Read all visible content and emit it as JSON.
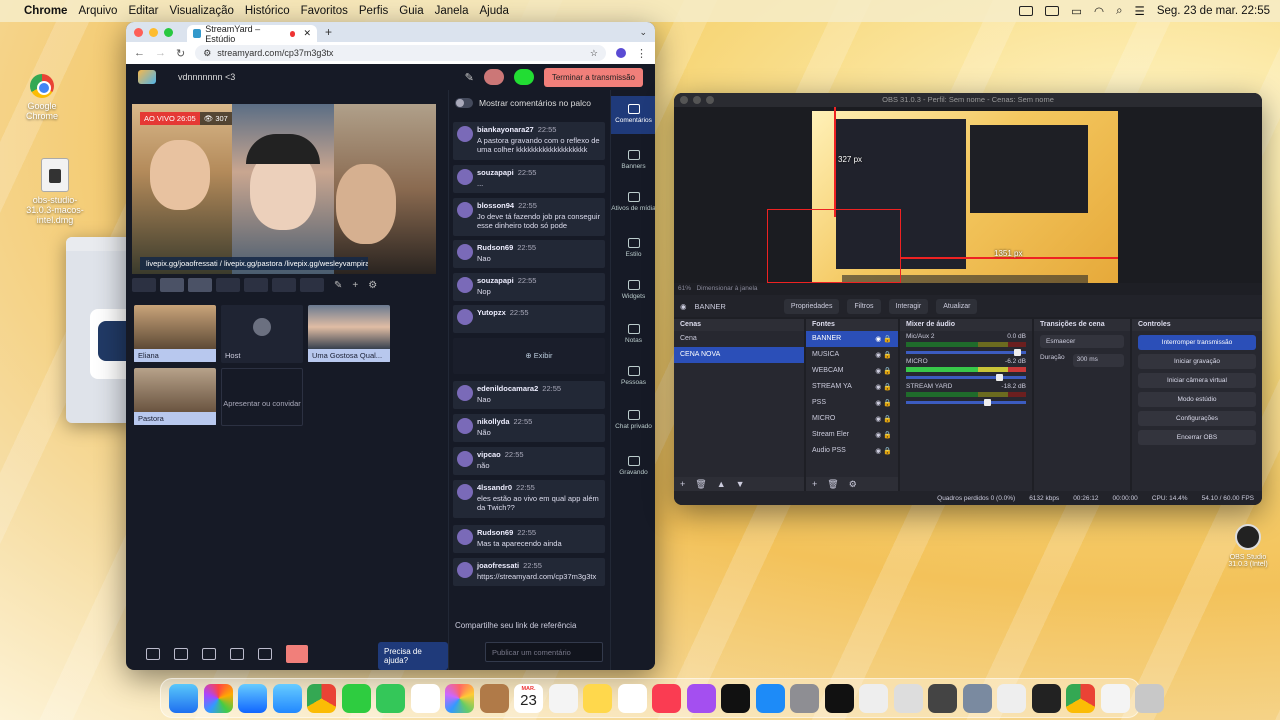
{
  "menubar": {
    "app": "Chrome",
    "items": [
      "Arquivo",
      "Editar",
      "Visualização",
      "Histórico",
      "Favoritos",
      "Perfis",
      "Guia",
      "Janela",
      "Ajuda"
    ],
    "datetime": "Seg. 23 de mar.  22:55"
  },
  "desktop": {
    "chrome_label": "Google Chrome",
    "dmg_label": "obs-studio-31.0.3-macos-intel.dmg",
    "obs_label": "OBS Studio 31.0.3 (Intel)"
  },
  "browser": {
    "tab_title": "StreamYard – Estúdio",
    "url": "streamyard.com/cp37m3g3tx"
  },
  "streamyard": {
    "title": "vdnnnnnnn <3",
    "end_button": "Terminar a transmissão",
    "live_badge": "AO VIVO 26:05",
    "viewers": "307",
    "banner_text": "livepix.gg/joaofressati / livepix.gg/pastora /livepix.gg/wesleyvampira",
    "participants": [
      {
        "name": "Eliana",
        "on_stage": true
      },
      {
        "name": "Host",
        "on_stage": false
      },
      {
        "name": "Uma Gostosa Qual...",
        "on_stage": true
      },
      {
        "name": "Pastora",
        "on_stage": true
      }
    ],
    "invite_label": "Apresentar ou convidar",
    "help_button": "Precisa de ajuda?",
    "chat": {
      "header": "Mostrar comentários no palco",
      "show_label": "Exibir",
      "share_label": "Compartilhe seu link de referência",
      "input_placeholder": "Publicar um comentário",
      "messages": [
        {
          "user": "biankayonara27",
          "time": "22:55",
          "text": "A pastora gravando com o reflexo de uma colher kkkkkkkkkkkkkkkkkkk"
        },
        {
          "user": "souzapapi",
          "time": "22:55",
          "text": "..."
        },
        {
          "user": "blosson94",
          "time": "22:55",
          "text": "Jo deve tá fazendo job pra conseguir esse dinheiro todo só pode"
        },
        {
          "user": "Rudson69",
          "time": "22:55",
          "text": "Nao"
        },
        {
          "user": "souzapapi",
          "time": "22:55",
          "text": "Nop"
        },
        {
          "user": "Yutopzx",
          "time": "22:55",
          "text": ""
        },
        {
          "user": "edenildocamara2",
          "time": "22:55",
          "text": "Nao"
        },
        {
          "user": "nikollyda",
          "time": "22:55",
          "text": "Não"
        },
        {
          "user": "vipcao",
          "time": "22:55",
          "text": "não"
        },
        {
          "user": "4lssandr0",
          "time": "22:55",
          "text": "eles estão ao vivo em qual app além da Twich??"
        },
        {
          "user": "Rudson69",
          "time": "22:55",
          "text": "Mas ta aparecendo ainda"
        },
        {
          "user": "joaofressati",
          "time": "22:55",
          "text": "https://streamyard.com/cp37m3g3tx"
        }
      ]
    },
    "side_panel": [
      "Comentários",
      "Banners",
      "Ativos de mídia",
      "Estilo",
      "Widgets",
      "Notas",
      "Pessoas",
      "Chat privado",
      "Gravando"
    ]
  },
  "obs": {
    "title": "OBS 31.0.3 - Perfil: Sem nome - Cenas: Sem nome",
    "zoom": "61%",
    "zoom_hint": "Dimensionar à janela",
    "px_label_1": "327 px",
    "px_label_2": "1351 px",
    "selected_source": "BANNER",
    "toolbar": [
      "Propriedades",
      "Filtros",
      "Interagir",
      "Atualizar"
    ],
    "docks": {
      "scenes_title": "Cenas",
      "scenes": [
        "Cena",
        "CENA NOVA"
      ],
      "sources_title": "Fontes",
      "sources": [
        "BANNER",
        "MUSICA",
        "WEBCAM",
        "STREAM YA",
        "PSS",
        "MICRO",
        "Stream Eler",
        "Audio PSS"
      ],
      "mixer_title": "Mixer de áudio",
      "mixer": [
        {
          "name": "Mic/Aux 2",
          "db": "0.0 dB"
        },
        {
          "name": "MICRO",
          "db": "-6.2 dB"
        },
        {
          "name": "STREAM YARD",
          "db": "-18.2 dB"
        }
      ],
      "transitions_title": "Transições de cena",
      "transition": "Esmaecer",
      "duration_label": "Duração",
      "duration": "300 ms",
      "controls_title": "Controles",
      "controls": [
        "Interromper transmissão",
        "Iniciar gravação",
        "Iniciar câmera virtual",
        "Modo estúdio",
        "Configurações",
        "Encerrar OBS"
      ]
    },
    "status": {
      "dropped": "Quadros perdidos 0 (0.0%)",
      "bitrate": "6132 kbps",
      "stream_time": "00:26:12",
      "rec_time": "00:00:00",
      "cpu": "CPU: 14.4%",
      "fps": "54.10 / 60.00 FPS"
    }
  },
  "dock": {
    "calendar_month": "MAR.",
    "calendar_day": "23"
  }
}
